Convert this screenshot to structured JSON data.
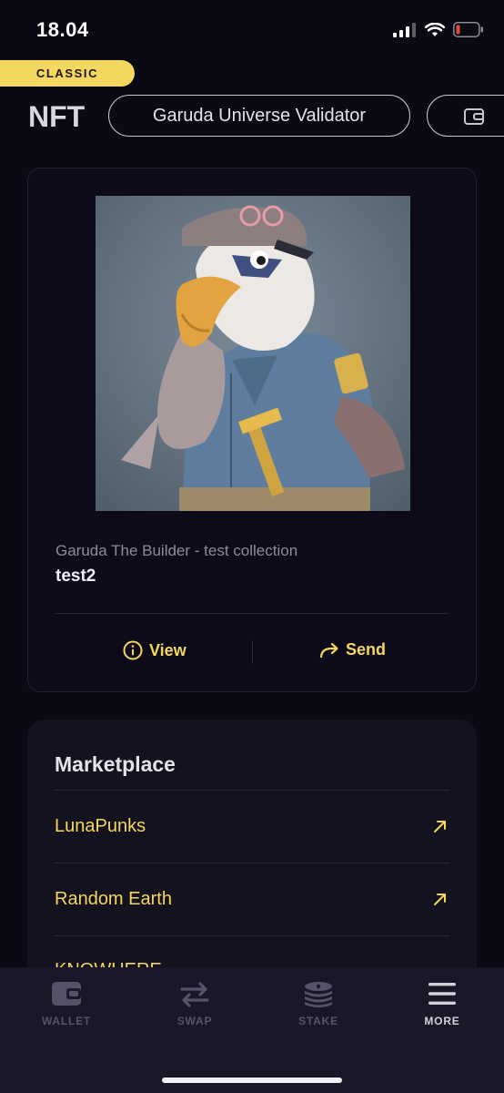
{
  "status_bar": {
    "time": "18.04"
  },
  "badge": {
    "label": "CLASSIC"
  },
  "header": {
    "title": "NFT",
    "chips": [
      {
        "label": "Garuda Universe Validator"
      }
    ]
  },
  "nft": {
    "collection": "Garuda The Builder - test collection",
    "name": "test2",
    "actions": {
      "view": "View",
      "send": "Send"
    }
  },
  "marketplace": {
    "title": "Marketplace",
    "items": [
      {
        "label": "LunaPunks"
      },
      {
        "label": "Random Earth"
      },
      {
        "label": "KNOWHERE"
      }
    ]
  },
  "bottom_nav": {
    "items": [
      {
        "label": "WALLET",
        "icon": "wallet-icon"
      },
      {
        "label": "SWAP",
        "icon": "swap-icon"
      },
      {
        "label": "STAKE",
        "icon": "stake-icon"
      },
      {
        "label": "MORE",
        "icon": "menu-icon",
        "active": true
      }
    ]
  },
  "colors": {
    "accent": "#f4d75e",
    "background": "#0b0914",
    "card": "#14121f",
    "nav": "#1a1828"
  }
}
